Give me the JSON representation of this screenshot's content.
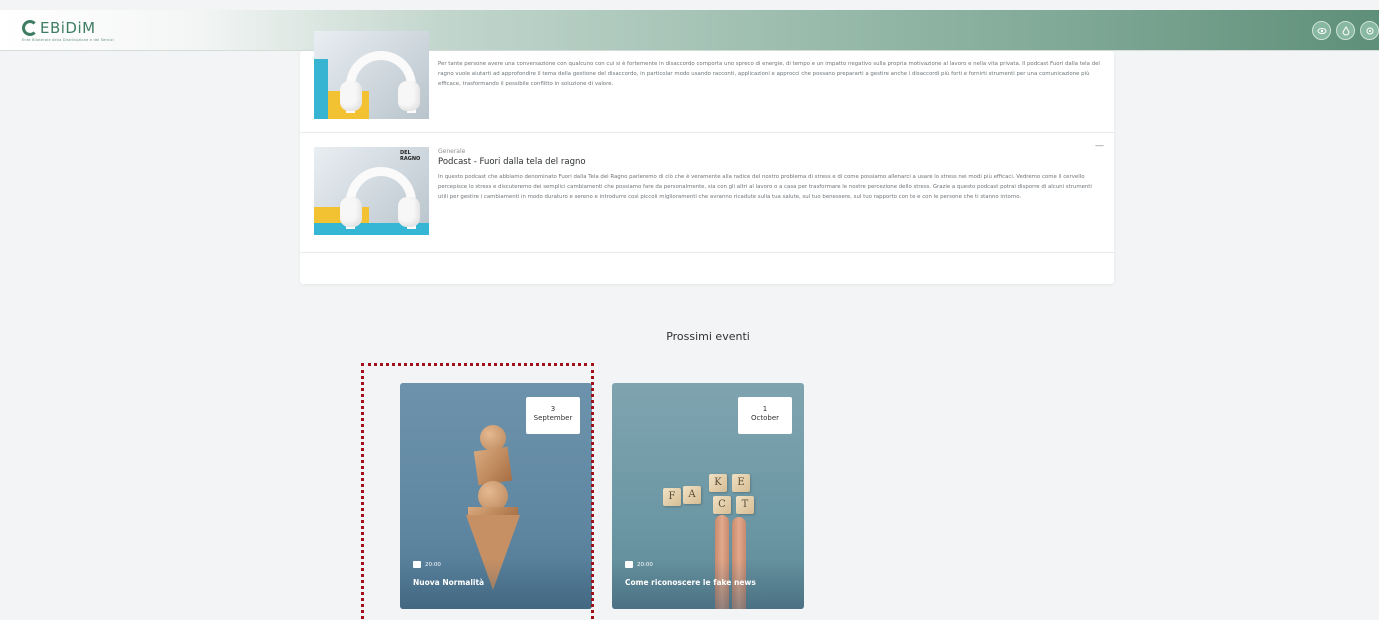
{
  "header": {
    "brand": "EBiDiM",
    "brand_sub": "Ente Bilaterale della Distribuzione e dei Servizi",
    "icons": [
      "eye-icon",
      "drop-icon",
      "settings-icon"
    ],
    "accent": "#3f7d62"
  },
  "podcasts": [
    {
      "category": "",
      "title": "",
      "description": "Per tante persone avere una conversazione con qualcuno con cui si è fortemente in disaccordo comporta uno spreco di energie, di tempo e un impatto negativo sulla propria motivazione al lavoro e nella vita privata. Il podcast Fuori dalla tela del ragno vuole aiutarti ad approfondire il tema della gestione del disaccordo, in particolar modo usando racconti, applicazioni e approcci che possano prepararti a gestire anche i disaccordi più forti e fornirti strumenti per una comunicazione più efficace, trasformando il possibile conflitto in soluzione di valore."
    },
    {
      "thumb_caption": "DEL RAGNO",
      "category": "Generale",
      "title": "Podcast - Fuori dalla tela del ragno",
      "description": "In questo podcast che abbiamo denominato Fuori dalla Tela del Ragno parleremo di ciò che è veramente alla radice del nostro problema di stress e di come possiamo allenarci a usare lo stress nei modi più efficaci. Vedremo come il cervello percepisce lo stress e discuteremo dei semplici cambiamenti che possiamo fare da personalmente, sia con gli altri al lavoro o a casa per trasformare le nostre percezione dello stress. Grazie a questo podcast potrai disporre di alcuni strumenti utili per gestire i cambiamenti in modo duraturo e sereno e introdurre così piccoli miglioramenti che avranno ricadute sulla tua salute, sul tuo benessere, sul tuo rapporto con te e con le persone che ti stanno intorno.",
      "collapse_label": "—"
    }
  ],
  "events_section": {
    "title": "Prossimi eventi",
    "events": [
      {
        "day": "3",
        "month": "September",
        "time": "20:00",
        "title": "Nuova Normalità"
      },
      {
        "day": "1",
        "month": "October",
        "time": "20:00",
        "title": "Come riconoscere le fake news"
      }
    ]
  },
  "fake_tiles": [
    "F",
    "A",
    "K",
    "E",
    "C",
    "T"
  ]
}
